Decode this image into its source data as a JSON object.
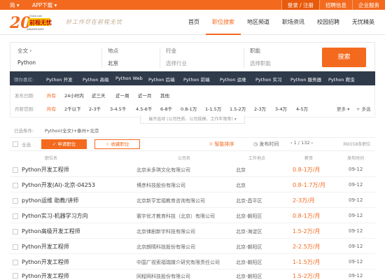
{
  "topbar": {
    "left": "简 ▾",
    "app": "APP下载 ▾",
    "login": "登录 / 注册",
    "recruit": "招聘信息",
    "enterprise": "企业服务"
  },
  "logo": {
    "number": "20",
    "brand": "前程无忧",
    "sub": "ANNIVERSARY",
    "domain": "51job.com"
  },
  "slogan": "好工作尽在前程无忧",
  "nav": [
    "首页",
    "职位搜索",
    "地区频道",
    "职场资讯",
    "校园招聘",
    "无忧精英"
  ],
  "search": {
    "cat_label": "全文 ›",
    "keyword": "Python",
    "area_label": "地点",
    "area": "北京",
    "industry_label": "行业",
    "industry": "选择行业",
    "func_label": "职能",
    "func": "选择职能",
    "button": "搜索"
  },
  "hot": {
    "label": "猜你喜欢:",
    "items": [
      "Python 开发",
      "Python 高级",
      "Python Web",
      "Python 后端",
      "Python 前端",
      "Python 运维",
      "Python 实习",
      "Python 服务器",
      "Python 爬虫"
    ]
  },
  "filters": {
    "date_label": "发布日期:",
    "date_opts": [
      "所有",
      "24小时内",
      "近三天",
      "近一周",
      "近一月",
      "其他"
    ],
    "salary_label": "月薪范围:",
    "salary_opts": [
      "所有",
      "2千以下",
      "2-3千",
      "3-4.5千",
      "4.5-6千",
      "6-8千",
      "0.8-1万",
      "1-1.5万",
      "1.5-2万",
      "2-3万",
      "3-4万",
      "4-5万"
    ],
    "more": "更多 ▾",
    "multi": "+ 多选",
    "expand": "展开选项 (公司性质、公司规模、工作年限等) ▾"
  },
  "conditions": {
    "label": "已选条件:",
    "value": "Python(全文)+泰州+北京"
  },
  "toolbar": {
    "select_all": "全选",
    "apply": "申请职位",
    "fav": "收藏职位",
    "smart": "智能排序",
    "time": "发布时间",
    "page": "‹ 1 / 132 ›",
    "total": "共6558条职位"
  },
  "table_head": {
    "title": "职位名",
    "company": "公司名",
    "location": "工作地点",
    "salary": "薪资",
    "date": "发布时间"
  },
  "rows": [
    {
      "title": "Python开发工程师",
      "company": "北京米多琪文化有限公司",
      "location": "北京",
      "salary": "0.8-1万/月",
      "date": "09-12"
    },
    {
      "title": "Python开发(AI)-北京-04253",
      "company": "博彦科技股份有限公司",
      "location": "北京",
      "salary": "0.8-1.7万/月",
      "date": "09-12"
    },
    {
      "title": "python运维 助教/讲师",
      "company": "北京新亨宏福教育咨询有限公司",
      "location": "北京-昌平区",
      "salary": "2-3万/月",
      "date": "09-12"
    },
    {
      "title": "Python实习-机器学习方向",
      "company": "寰宇优才教育科技（北京）有限公司",
      "location": "北京-朝阳区",
      "salary": "0.8-1万/月",
      "date": "09-12"
    },
    {
      "title": "Python高级开发工程师",
      "company": "北京律剧新宇科技有限公司",
      "location": "北京-海淀区",
      "salary": "1.5-2万/月",
      "date": "09-12"
    },
    {
      "title": "Python开发工程师",
      "company": "北京朗晴科技股份有限公司",
      "location": "北京-朝阳区",
      "salary": "2-2.5万/月",
      "date": "09-12"
    },
    {
      "title": "Python开发工程师",
      "company": "中国广视索福瑞媒介研究有限责任公司",
      "location": "北京-朝阳区",
      "salary": "1-1.5万/月",
      "date": "09-12"
    },
    {
      "title": "Python开发工程师",
      "company": "同程网科技股份有限公司",
      "location": "北京-朝阳区",
      "salary": "1.5-2万/月",
      "date": "09-12"
    }
  ],
  "colors": {
    "accent": "#f36a1e",
    "hotbar": "#2f3a4b"
  }
}
